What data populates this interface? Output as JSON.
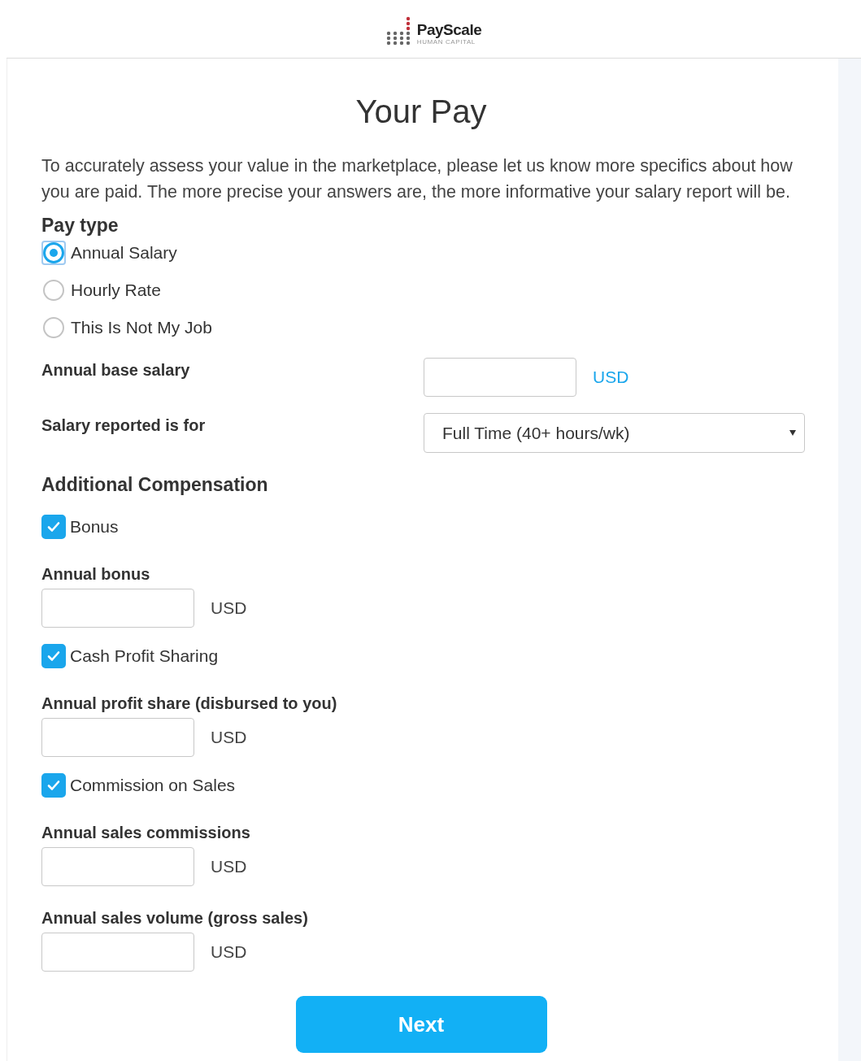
{
  "header": {
    "logo_text": "PayScale",
    "logo_tagline": "HUMAN CAPITAL"
  },
  "title": "Your Pay",
  "intro": "To accurately assess your value in the marketplace, please let us know more specifics about how you are paid. The more precise your answers are, the more informative your salary report will be.",
  "pay_type": {
    "label": "Pay type",
    "options": [
      {
        "label": "Annual Salary",
        "selected": true
      },
      {
        "label": "Hourly Rate",
        "selected": false
      },
      {
        "label": "This Is Not My Job",
        "selected": false
      }
    ]
  },
  "base_salary": {
    "label": "Annual base salary",
    "currency": "USD"
  },
  "salary_for": {
    "label": "Salary reported is for",
    "value": "Full Time (40+ hours/wk)"
  },
  "additional": {
    "heading": "Additional Compensation",
    "items": [
      {
        "label": "Bonus",
        "checked": true,
        "fields": [
          {
            "label": "Annual bonus",
            "currency": "USD"
          }
        ]
      },
      {
        "label": "Cash Profit Sharing",
        "checked": true,
        "fields": [
          {
            "label": "Annual profit share (disbursed to you)",
            "currency": "USD"
          }
        ]
      },
      {
        "label": "Commission on Sales",
        "checked": true,
        "fields": [
          {
            "label": "Annual sales commissions",
            "currency": "USD"
          },
          {
            "label": "Annual sales volume (gross sales)",
            "currency": "USD"
          }
        ]
      }
    ]
  },
  "next_button": "Next"
}
